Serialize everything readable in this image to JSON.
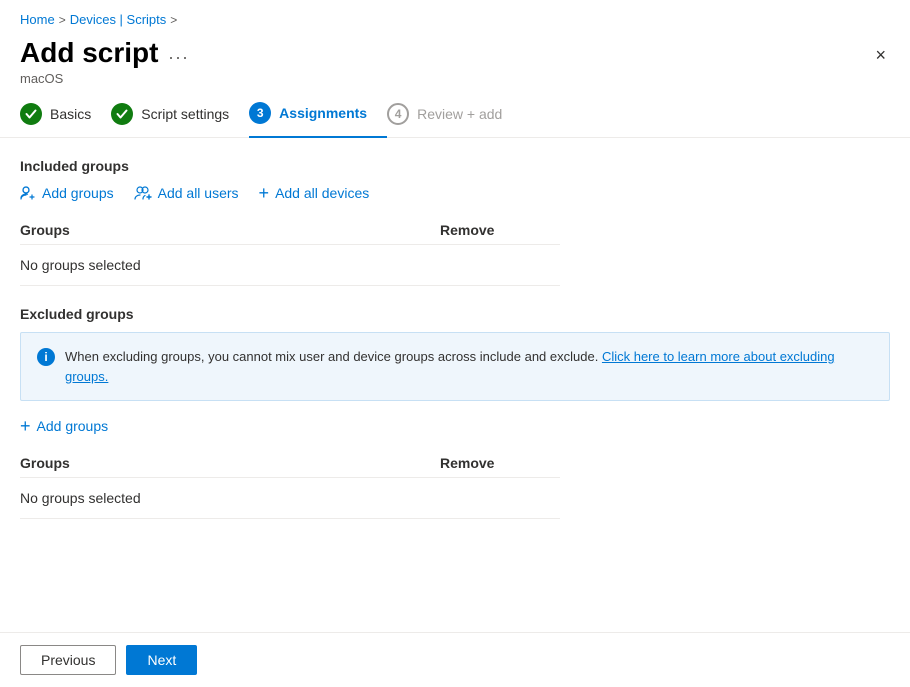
{
  "breadcrumb": {
    "home": "Home",
    "separator1": ">",
    "devices_scripts": "Devices | Scripts",
    "separator2": ">"
  },
  "header": {
    "title": "Add script",
    "ellipsis": "...",
    "subtitle": "macOS",
    "close_label": "×"
  },
  "steps": [
    {
      "id": "basics",
      "label": "Basics",
      "number": "1",
      "status": "complete"
    },
    {
      "id": "script-settings",
      "label": "Script settings",
      "number": "2",
      "status": "complete"
    },
    {
      "id": "assignments",
      "label": "Assignments",
      "number": "3",
      "status": "current"
    },
    {
      "id": "review-add",
      "label": "Review + add",
      "number": "4",
      "status": "pending"
    }
  ],
  "included_groups": {
    "section_title": "Included groups",
    "actions": [
      {
        "id": "add-groups",
        "label": "Add groups",
        "icon": "person-add"
      },
      {
        "id": "add-all-users",
        "label": "Add all users",
        "icon": "people-add"
      },
      {
        "id": "add-all-devices",
        "label": "Add all devices",
        "icon": "plus"
      }
    ],
    "table": {
      "col_groups": "Groups",
      "col_remove": "Remove",
      "empty_text": "No groups selected"
    }
  },
  "excluded_groups": {
    "section_title": "Excluded groups",
    "info_message": "When excluding groups, you cannot mix user and device groups across include and exclude.",
    "info_link_text": "Click here to learn more about excluding groups.",
    "add_groups_label": "Add groups",
    "table": {
      "col_groups": "Groups",
      "col_remove": "Remove",
      "empty_text": "No groups selected"
    }
  },
  "footer": {
    "previous_label": "Previous",
    "next_label": "Next"
  }
}
